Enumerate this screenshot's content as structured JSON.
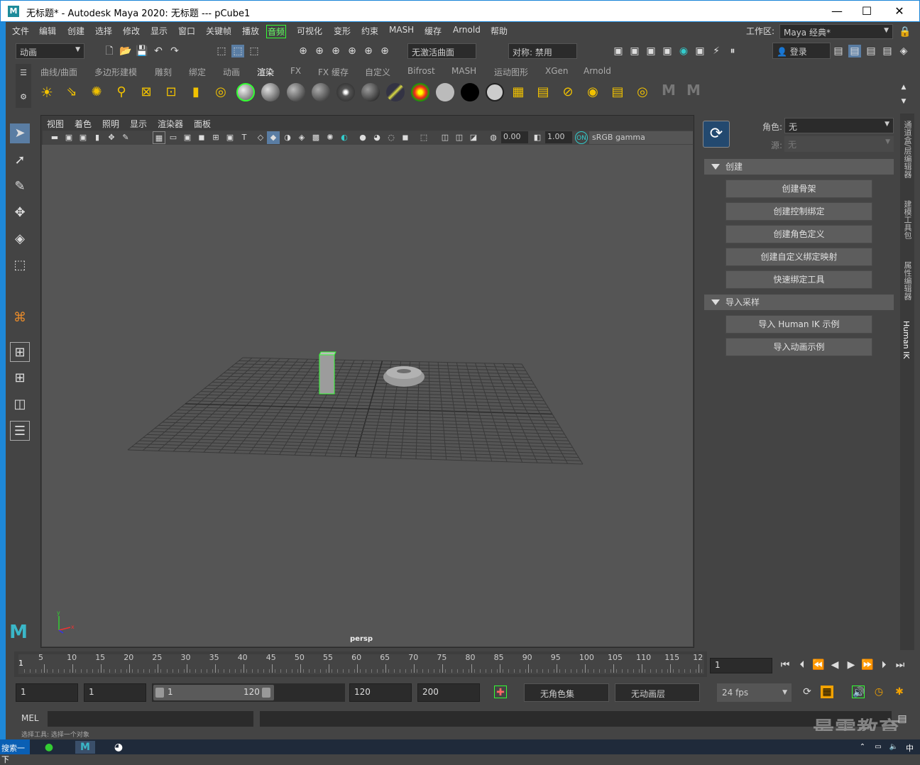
{
  "title": {
    "text": "无标题* - Autodesk Maya 2020: 无标题   ---   pCube1",
    "minimize": "—",
    "maximize": "☐",
    "close": "✕"
  },
  "menu": {
    "items": [
      "文件",
      "编辑",
      "创建",
      "选择",
      "修改",
      "显示",
      "窗口",
      "关键帧",
      "播放",
      "音频",
      "可视化",
      "变形",
      "约束",
      "MASH",
      "缓存",
      "Arnold",
      "帮助"
    ],
    "workspace_label": "工作区:",
    "workspace_value": "Maya 经典*"
  },
  "status": {
    "mode": "动画",
    "curve": "无激活曲面",
    "symmetry": "对称: 禁用",
    "login": "登录"
  },
  "shelf_tabs": [
    "曲线/曲面",
    "多边形建模",
    "雕刻",
    "绑定",
    "动画",
    "渲染",
    "FX",
    "FX 缓存",
    "自定义",
    "Bifrost",
    "MASH",
    "运动图形",
    "XGen",
    "Arnold"
  ],
  "shelf_active": "渲染",
  "viewport": {
    "menus": [
      "视图",
      "着色",
      "照明",
      "显示",
      "渲染器",
      "面板"
    ],
    "val1": "0.00",
    "val2": "1.00",
    "colorspace": "sRGB gamma",
    "camera": "persp"
  },
  "hik": {
    "role_label": "角色:",
    "role_value": "无",
    "source_label": "源:",
    "source_value": "无",
    "section_create": "创建",
    "btn_skeleton": "创建骨架",
    "btn_control": "创建控制绑定",
    "btn_chardef": "创建角色定义",
    "btn_custom": "创建自定义绑定映射",
    "btn_quick": "快速绑定工具",
    "section_import": "导入采样",
    "btn_import_ik": "导入 Human IK 示例",
    "btn_import_anim": "导入动画示例"
  },
  "side_tabs": [
    "通道盒/层编辑器",
    "建模工具包",
    "属性编辑器",
    "Human IK"
  ],
  "timeline": {
    "ticks": [
      "5",
      "10",
      "15",
      "20",
      "25",
      "30",
      "35",
      "40",
      "45",
      "50",
      "55",
      "60",
      "65",
      "70",
      "75",
      "80",
      "85",
      "90",
      "95",
      "100",
      "105",
      "110",
      "115",
      "12"
    ],
    "start_marker": "1",
    "current_frame": "1"
  },
  "range": {
    "start": "1",
    "playback_start": "1",
    "slider_start": "1",
    "slider_end": "120",
    "playback_end": "120",
    "end": "200",
    "charset": "无角色集",
    "animlayer": "无动画层",
    "fps": "24 fps"
  },
  "cmd": {
    "lang": "MEL"
  },
  "help": {
    "text": "选择工具: 选择一个对象"
  },
  "watermark": "最需教育",
  "taskbar": {
    "search": "搜索一下",
    "ime": "中"
  }
}
